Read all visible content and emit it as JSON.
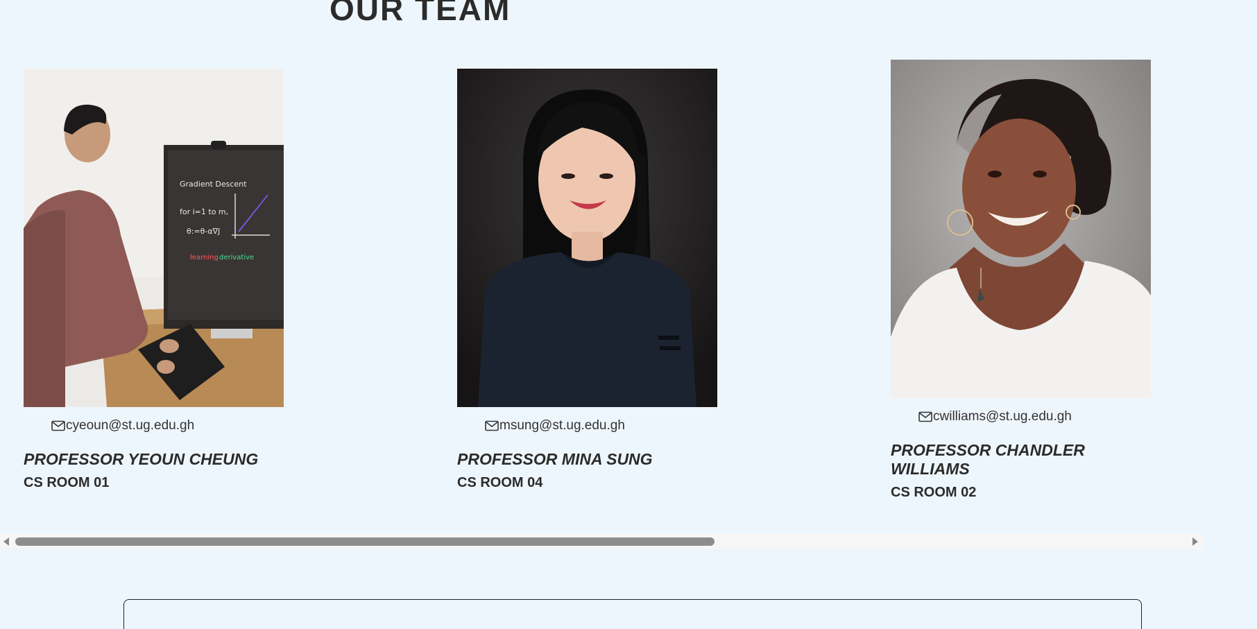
{
  "section": {
    "title": "OUR TEAM"
  },
  "team": [
    {
      "email": "cyeoun@st.ug.edu.gh",
      "name": "PROFESSOR YEOUN CHEUNG",
      "room": "CS ROOM 01",
      "photo_icon": "person-at-monitor-photo"
    },
    {
      "email": "msung@st.ug.edu.gh",
      "name": "PROFESSOR MINA SUNG",
      "room": "CS ROOM 04",
      "photo_icon": "portrait-photo"
    },
    {
      "email": "cwilliams@st.ug.edu.gh",
      "name": "PROFESSOR CHANDLER WILLIAMS",
      "room": "CS ROOM 02",
      "photo_icon": "portrait-photo"
    }
  ],
  "scrollbar": {
    "position_fraction": 0.0
  }
}
